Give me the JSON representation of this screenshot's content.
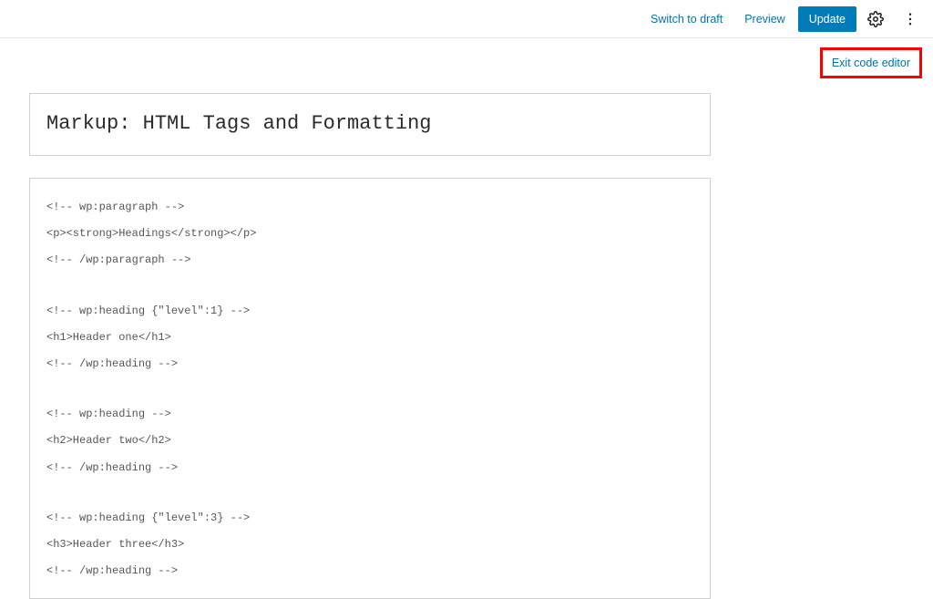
{
  "topbar": {
    "switch_draft": "Switch to draft",
    "preview": "Preview",
    "update": "Update"
  },
  "exit_label": "Exit code editor",
  "title": "Markup: HTML Tags and Formatting",
  "code_lines": [
    "<!-- wp:paragraph -->",
    "<p><strong>Headings</strong></p>",
    "<!-- /wp:paragraph -->",
    "",
    "<!-- wp:heading {\"level\":1} -->",
    "<h1>Header one</h1>",
    "<!-- /wp:heading -->",
    "",
    "<!-- wp:heading -->",
    "<h2>Header two</h2>",
    "<!-- /wp:heading -->",
    "",
    "<!-- wp:heading {\"level\":3} -->",
    "<h3>Header three</h3>",
    "<!-- /wp:heading -->"
  ]
}
